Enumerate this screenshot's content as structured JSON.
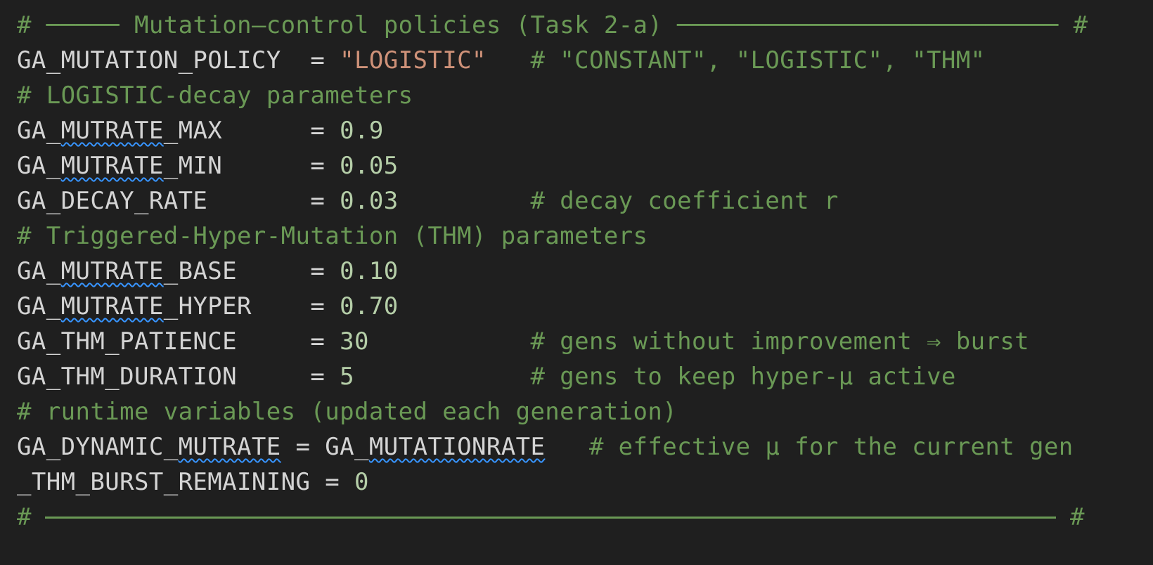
{
  "colors": {
    "background": "#1f1f1f",
    "comment": "#6a9955",
    "string": "#ce9178",
    "number": "#b5cea8",
    "identifier": "#d4d4d4",
    "squiggle": "#3794ff"
  },
  "code": {
    "header_banner": {
      "prefix": "#",
      "title": "Mutation–control policies (Task 2-a)",
      "suffix": "#"
    },
    "line_policy": {
      "name": "GA_MUTATION_POLICY",
      "assign": " = ",
      "quote_open": "\"",
      "value": "LOGISTIC",
      "quote_close": "\"",
      "comment": "# \"CONSTANT\", \"LOGISTIC\", \"THM\""
    },
    "comment_logistic": "# LOGISTIC-decay parameters",
    "line_max": {
      "name_a": "GA_",
      "name_b": "MUTRATE",
      "name_c": "_MAX",
      "assign": "= ",
      "value": "0.9"
    },
    "line_min": {
      "name_a": "GA_",
      "name_b": "MUTRATE",
      "name_c": "_MIN",
      "assign": "= ",
      "value": "0.05"
    },
    "line_decay": {
      "name": "GA_DECAY_RATE",
      "assign": "= ",
      "value": "0.03",
      "comment": "# decay coefficient r"
    },
    "comment_thm": "# Triggered-Hyper-Mutation (THM) parameters",
    "line_base": {
      "name_a": "GA_",
      "name_b": "MUTRATE",
      "name_c": "_BASE",
      "assign": "= ",
      "value": "0.10"
    },
    "line_hyper": {
      "name_a": "GA_",
      "name_b": "MUTRATE",
      "name_c": "_HYPER",
      "assign": "= ",
      "value": "0.70"
    },
    "line_patience": {
      "name": "GA_THM_PATIENCE",
      "assign": "= ",
      "value": "30",
      "comment": "# gens without improvement ⇒ burst"
    },
    "line_duration": {
      "name": "GA_THM_DURATION",
      "assign": "= ",
      "value": "5",
      "comment": "# gens to keep hyper-μ active"
    },
    "comment_runtime": "# runtime variables (updated each generation)",
    "line_dynamic": {
      "name_a": "GA_DYNAMIC_",
      "name_b": "MUTRATE",
      "assign": " = ",
      "rhs_a": "GA_",
      "rhs_b": "MUTATIONRATE",
      "comment": "# effective μ for the current gen"
    },
    "line_burst": {
      "name": "_THM_BURST_REMAINING",
      "assign": " = ",
      "value": "0"
    },
    "footer_banner": {
      "prefix": "#",
      "suffix": "#"
    }
  }
}
